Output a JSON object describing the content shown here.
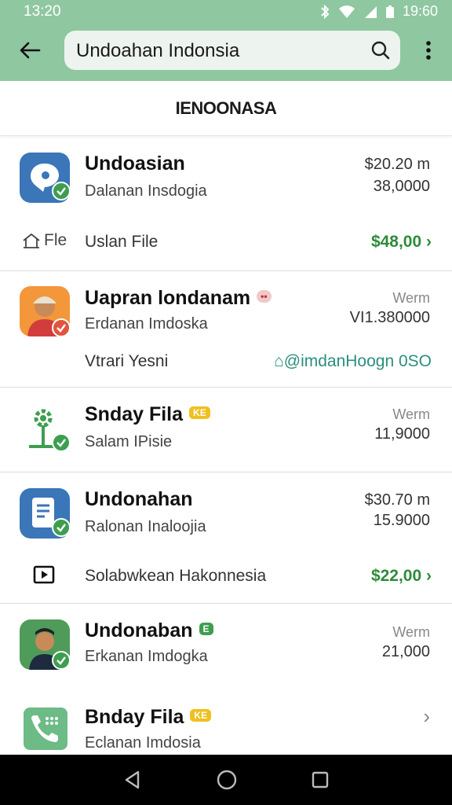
{
  "status": {
    "time": "13:20",
    "clock_right": "19:60"
  },
  "search": {
    "query": "Undoahan Indonsia"
  },
  "section": {
    "title": "IENOONASA"
  },
  "items": [
    {
      "name": "Undoasian",
      "subtitle": "Dalanan Insdogia",
      "amount_top": "$20.20 m",
      "amount_bottom": "38,0000",
      "footer_icon": "home-icon",
      "footer_icon_text": "Fle",
      "footer_label": "Uslan File",
      "footer_value": "$48,00 ›"
    },
    {
      "name": "Uapran londanam",
      "tag": "••",
      "subtitle": "Erdanan Imdoska",
      "amount_top": "Werm",
      "amount_bottom": "VI1.380000",
      "footer_label": "Vtrari Yesni",
      "footer_value": "⌂@imdanHoogn 0SO"
    },
    {
      "name": "Snday Fila",
      "tag": "KE",
      "subtitle": "Salam IPisie",
      "amount_top": "Werm",
      "amount_bottom": "11,9000"
    },
    {
      "name": "Undonahan",
      "subtitle": "Ralonan Inaloojia",
      "amount_top": "$30.70 m",
      "amount_bottom": "15.9000",
      "footer_icon": "video-icon",
      "footer_label": "Solabwkean Hakonnesia",
      "footer_value": "$22,00 ›"
    },
    {
      "name": "Undonaban",
      "tag": "E",
      "subtitle": "Erkanan Imdogka",
      "amount_top": "Werm",
      "amount_bottom": "21,000"
    },
    {
      "name": "Bnday Fila",
      "tag": "KE",
      "subtitle": "Eclanan Imdosia",
      "chevron": "›"
    }
  ],
  "colors": {
    "appbar": "#8fc7a0",
    "accent_green": "#2e8b3b",
    "badge_green": "#3e9e50",
    "badge_red": "#e0553f"
  }
}
